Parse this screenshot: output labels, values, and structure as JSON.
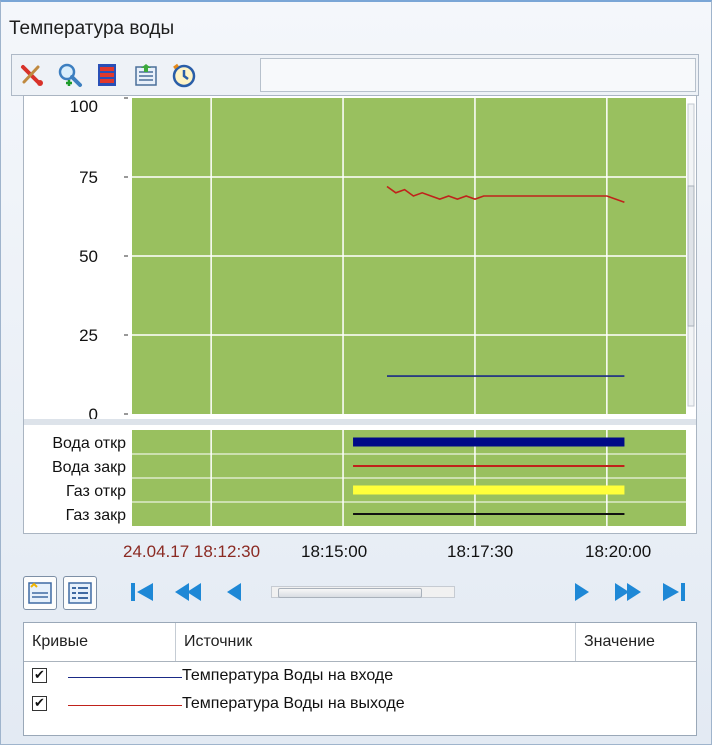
{
  "window": {
    "title": "Температура воды"
  },
  "toolbar": {
    "buttons": [
      "scissors-icon",
      "zoom-icon",
      "chart-settings-icon",
      "export-icon",
      "clock-icon"
    ]
  },
  "chart_data": {
    "type": "line",
    "ylim": [
      0,
      100
    ],
    "yticks": [
      "100",
      "75",
      "50",
      "25",
      "0"
    ],
    "x_tick_labels": [
      "24.04.17 18:12:30",
      "18:15:00",
      "18:17:30",
      "18:20:00"
    ],
    "series": [
      {
        "name": "Температура Воды на выходе",
        "color": "#c0221b",
        "x": [
          "18:15:50",
          "18:16:00",
          "18:16:10",
          "18:16:20",
          "18:16:30",
          "18:16:40",
          "18:16:50",
          "18:17:00",
          "18:17:10",
          "18:17:20",
          "18:17:30",
          "18:17:40",
          "18:18:00",
          "18:18:30",
          "18:19:00",
          "18:19:30",
          "18:20:00",
          "18:20:20"
        ],
        "values": [
          72,
          70,
          71,
          69,
          70,
          69,
          68,
          69,
          68,
          69,
          68,
          69,
          69,
          69,
          69,
          69,
          69,
          67
        ]
      },
      {
        "name": "Температура Воды на входе",
        "color": "#1a2a86",
        "x": [
          "18:15:50",
          "18:20:20"
        ],
        "values": [
          12,
          12
        ]
      }
    ],
    "discrete": {
      "labels": [
        "Вода откр",
        "Вода закр",
        "Газ откр",
        "Газ закр"
      ],
      "bars": [
        {
          "label": "Вода откр",
          "color": "#000a87",
          "start": "18:15:00",
          "end": "18:20:20",
          "thick": true
        },
        {
          "label": "Вода закр",
          "color": "#c0221b",
          "start": "18:15:00",
          "end": "18:20:20",
          "thick": false
        },
        {
          "label": "Газ откр",
          "color": "#ffff3a",
          "start": "18:15:00",
          "end": "18:20:20",
          "thick": true
        },
        {
          "label": "Газ закр",
          "color": "#111111",
          "start": "18:15:00",
          "end": "18:20:20",
          "thick": false
        }
      ]
    },
    "plot_bg": "#99c05f",
    "grid": true
  },
  "table": {
    "headers": [
      "Кривые",
      "Источник",
      "Значение"
    ],
    "rows": [
      {
        "checked": "✔",
        "color": "#1a2a86",
        "label": "Температура Воды на входе"
      },
      {
        "checked": "✔",
        "color": "#c0221b",
        "label": "Температура Воды на выходе"
      }
    ]
  },
  "colors": {
    "accent": "#1e88d6",
    "plot_bg": "#99c05f"
  }
}
